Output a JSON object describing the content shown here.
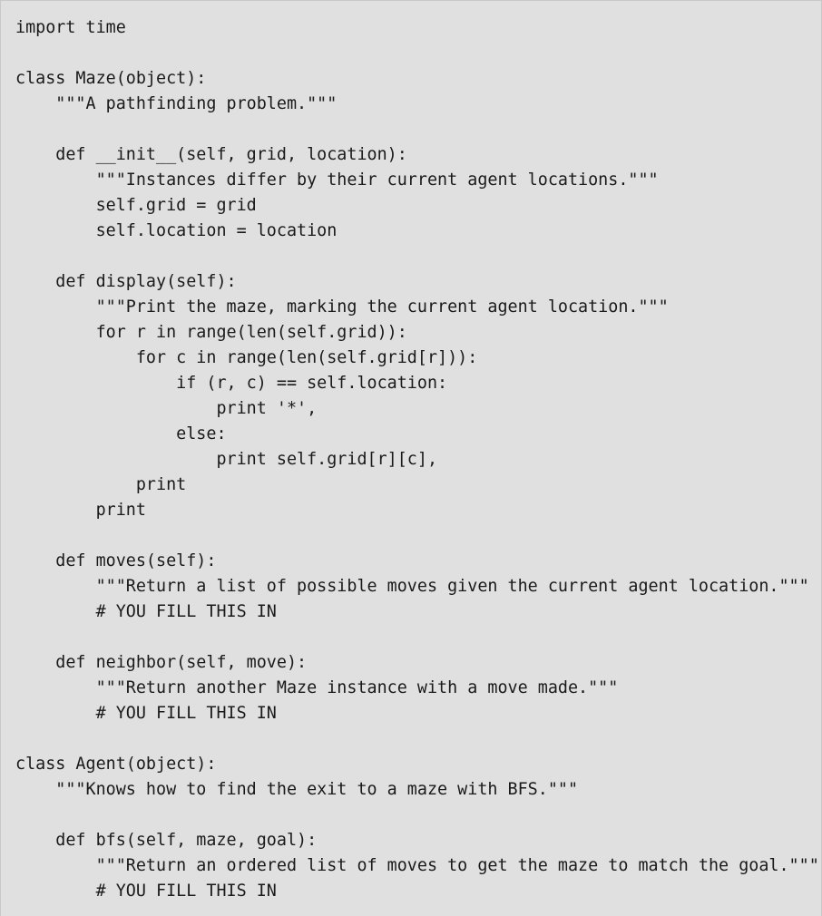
{
  "code_block": {
    "lines": [
      "import time",
      "",
      "class Maze(object):",
      "    \"\"\"A pathfinding problem.\"\"\"",
      "",
      "    def __init__(self, grid, location):",
      "        \"\"\"Instances differ by their current agent locations.\"\"\"",
      "        self.grid = grid",
      "        self.location = location",
      "",
      "    def display(self):",
      "        \"\"\"Print the maze, marking the current agent location.\"\"\"",
      "        for r in range(len(self.grid)):",
      "            for c in range(len(self.grid[r])):",
      "                if (r, c) == self.location:",
      "                    print '*',",
      "                else:",
      "                    print self.grid[r][c],",
      "            print",
      "        print",
      "",
      "    def moves(self):",
      "        \"\"\"Return a list of possible moves given the current agent location.\"\"\"",
      "        # YOU FILL THIS IN",
      "",
      "    def neighbor(self, move):",
      "        \"\"\"Return another Maze instance with a move made.\"\"\"",
      "        # YOU FILL THIS IN",
      "",
      "class Agent(object):",
      "    \"\"\"Knows how to find the exit to a maze with BFS.\"\"\"",
      "",
      "    def bfs(self, maze, goal):",
      "        \"\"\"Return an ordered list of moves to get the maze to match the goal.\"\"\"",
      "        # YOU FILL THIS IN"
    ]
  }
}
